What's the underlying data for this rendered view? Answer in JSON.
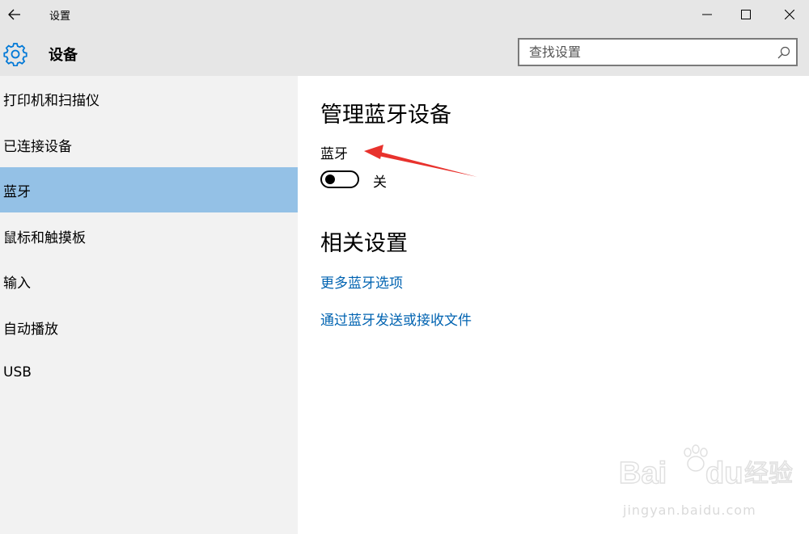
{
  "window": {
    "title": "设置",
    "controls": {
      "back": "arrow-left-icon",
      "minimize": "minimize-icon",
      "maximize": "maximize-icon",
      "close": "close-icon"
    }
  },
  "header": {
    "title": "设备",
    "icon": "gear-icon",
    "accent": "#0078d7"
  },
  "search": {
    "placeholder": "查找设置",
    "value": ""
  },
  "sidebar": {
    "selected_color": "#94c1e6",
    "items": [
      {
        "label": "打印机和扫描仪",
        "selected": false
      },
      {
        "label": "已连接设备",
        "selected": false
      },
      {
        "label": "蓝牙",
        "selected": true
      },
      {
        "label": "鼠标和触摸板",
        "selected": false
      },
      {
        "label": "输入",
        "selected": false
      },
      {
        "label": "自动播放",
        "selected": false
      },
      {
        "label": "USB",
        "selected": false
      }
    ]
  },
  "main": {
    "title": "管理蓝牙设备",
    "bluetooth_label": "蓝牙",
    "toggle_state": "关",
    "toggle_on": false,
    "related_title": "相关设置",
    "links": [
      {
        "label": "更多蓝牙选项"
      },
      {
        "label": "通过蓝牙发送或接收文件"
      }
    ],
    "link_color": "#0063b1"
  },
  "annotation": {
    "color": "#e8322d"
  },
  "watermark": {
    "brand": "Bai",
    "brand2": "du",
    "cn": "经验",
    "url": "jingyan.baidu.com"
  }
}
